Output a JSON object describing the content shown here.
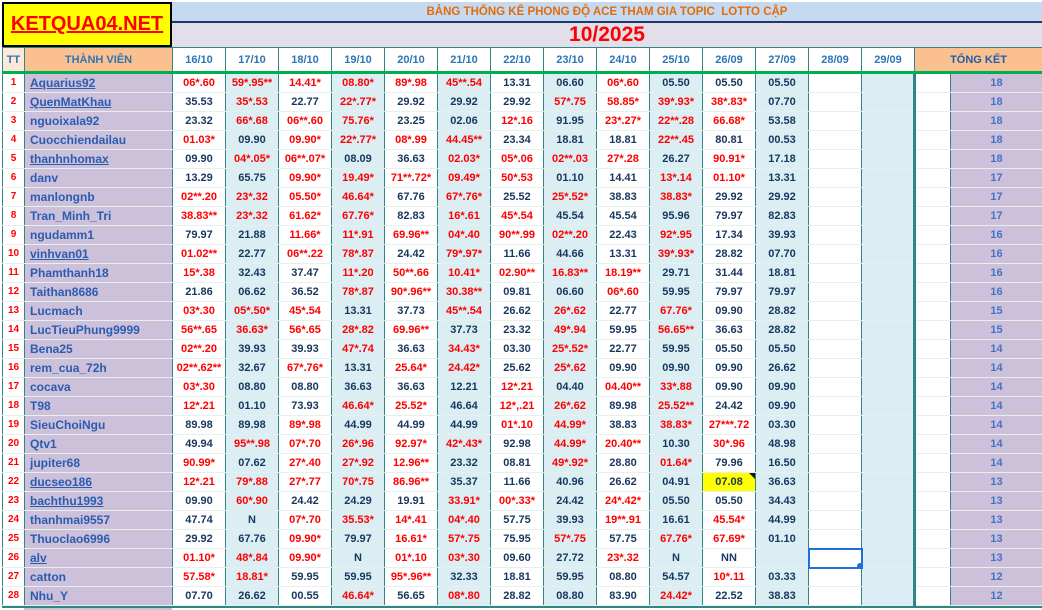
{
  "brand": {
    "site": "KETQUA04.NET"
  },
  "title_bar": {
    "title": "BẢNG THỐNG KÊ PHONG ĐỘ ACE THAM GIA TOPIC  LOTTO CẬP",
    "month": "10/2025"
  },
  "table": {
    "tt_label": "TT",
    "member_label": "THÀNH VIÊN",
    "total_label": "TỔNG KẾT",
    "dates": [
      "16/10",
      "17/10",
      "18/10",
      "19/10",
      "20/10",
      "21/10",
      "22/10",
      "23/10",
      "24/10",
      "25/10",
      "26/09",
      "27/09",
      "28/09",
      "29/09"
    ],
    "rows": [
      {
        "tt": 1,
        "name": "Aquarius92",
        "underline": true,
        "values": [
          "06*.60",
          "59*.95**",
          "14.41*",
          "08.80*",
          "89*.98",
          "45**.54",
          "13.31",
          "06.60",
          "06*.60",
          "05.50",
          "05.50",
          "05.50",
          "",
          ""
        ],
        "total": 18
      },
      {
        "tt": 2,
        "name": "QuenMatKhau",
        "underline": true,
        "values": [
          "35.53",
          "35*.53",
          "22.77",
          "22*.77*",
          "29.92",
          "29.92",
          "29.92",
          "57*.75",
          "58.85*",
          "39*.93*",
          "38*.83*",
          "07.70",
          "",
          ""
        ],
        "total": 18
      },
      {
        "tt": 3,
        "name": "nguoixala92",
        "underline": false,
        "values": [
          "23.32",
          "66*.68",
          "06**.60",
          "75.76*",
          "23.25",
          "02.06",
          "12*.16",
          "91.95",
          "23*.27*",
          "22**.28",
          "66.68*",
          "53.58",
          "",
          ""
        ],
        "total": 18
      },
      {
        "tt": 4,
        "name": "Cuocchiendailau",
        "underline": false,
        "values": [
          "01.03*",
          "09.90",
          "09.90*",
          "22*.77*",
          "08*.99",
          "44.45**",
          "23.34",
          "18.81",
          "18.81",
          "22**.45",
          "80.81",
          "00.53",
          "",
          ""
        ],
        "total": 18
      },
      {
        "tt": 5,
        "name": "thanhnhomax",
        "underline": true,
        "values": [
          "09.90",
          "04*.05*",
          "06**.07*",
          "08.09",
          "36.63",
          "02.03*",
          "05*.06",
          "02**.03",
          "27*.28",
          "26.27",
          "90.91*",
          "17.18",
          "",
          ""
        ],
        "total": 18
      },
      {
        "tt": 6,
        "name": "danv",
        "underline": false,
        "values": [
          "13.29",
          "65.75",
          "09.90*",
          "19.49*",
          "71**.72*",
          "09.49*",
          "50*.53",
          "01.10",
          "14.41",
          "13*.14",
          "01.10*",
          "13.31",
          "",
          ""
        ],
        "total": 17
      },
      {
        "tt": 7,
        "name": "manlongnb",
        "underline": false,
        "values": [
          "02**.20",
          "23*.32",
          "05.50*",
          "46.64*",
          "67.76",
          "67*.76*",
          "25.52",
          "25*.52*",
          "38.83",
          "38.83*",
          "29.92",
          "29.92",
          "",
          ""
        ],
        "total": 17
      },
      {
        "tt": 8,
        "name": "Tran_Minh_Tri",
        "underline": false,
        "values": [
          "38.83**",
          "23*.32",
          "61.62*",
          "67.76*",
          "82.83",
          "16*.61",
          "45*.54",
          "45.54",
          "45.54",
          "95.96",
          "79.97",
          "82.83",
          "",
          ""
        ],
        "total": 17
      },
      {
        "tt": 9,
        "name": "ngudamm1",
        "underline": false,
        "values": [
          "79.97",
          "21.88",
          "11.66*",
          "11*.91",
          "69.96**",
          "04*.40",
          "90**.99",
          "02**.20",
          "22.43",
          "92*.95",
          "17.34",
          "39.93",
          "",
          ""
        ],
        "total": 16
      },
      {
        "tt": 10,
        "name": "vinhvan01",
        "underline": true,
        "values": [
          "01.02**",
          "22.77",
          "06**.22",
          "78*.87",
          "24.42",
          "79*.97*",
          "11.66",
          "44.66",
          "13.31",
          "39*.93*",
          "28.82",
          "07.70",
          "",
          ""
        ],
        "total": 16
      },
      {
        "tt": 11,
        "name": "Phamthanh18",
        "underline": false,
        "values": [
          "15*.38",
          "32.43",
          "37.47",
          "11*.20",
          "50**.66",
          "10.41*",
          "02.90**",
          "16.83**",
          "18.19**",
          "29.71",
          "31.44",
          "18.81",
          "",
          ""
        ],
        "total": 16
      },
      {
        "tt": 12,
        "name": "Taithan8686",
        "underline": false,
        "values": [
          "21.86",
          "06.62",
          "36.52",
          "78*.87",
          "90*.96**",
          "30.38**",
          "09.81",
          "06.60",
          "06*.60",
          "59.95",
          "79.97",
          "79.97",
          "",
          ""
        ],
        "total": 16
      },
      {
        "tt": 13,
        "name": "Lucmach",
        "underline": false,
        "values": [
          "03*.30",
          "05*.50*",
          "45*.54",
          "13.31",
          "37.73",
          "45**.54",
          "26.62",
          "26*.62",
          "22.77",
          "67.76*",
          "09.90",
          "28.82",
          "",
          ""
        ],
        "total": 15
      },
      {
        "tt": 14,
        "name": "LucTieuPhung9999",
        "underline": false,
        "values": [
          "56**.65",
          "36.63*",
          "56*.65",
          "28*.82",
          "69.96**",
          "37.73",
          "23.32",
          "49*.94",
          "59.95",
          "56.65**",
          "36.63",
          "28.82",
          "",
          ""
        ],
        "total": 15
      },
      {
        "tt": 15,
        "name": "Bena25",
        "underline": false,
        "values": [
          "02**.20",
          "39.93",
          "39.93",
          "47*.74",
          "36.63",
          "34.43*",
          "03.30",
          "25*.52*",
          "22.77",
          "59.95",
          "05.50",
          "05.50",
          "",
          ""
        ],
        "total": 14
      },
      {
        "tt": 16,
        "name": "rem_cua_72h",
        "underline": false,
        "values": [
          "02**.62**",
          "32.67",
          "67*.76*",
          "13.31",
          "25.64*",
          "24.42*",
          "25.62",
          "25*.62",
          "09.90",
          "09.90",
          "09.90",
          "26.62",
          "",
          ""
        ],
        "total": 14
      },
      {
        "tt": 17,
        "name": "cocava",
        "underline": false,
        "values": [
          "03*.30",
          "08.80",
          "08.80",
          "36.63",
          "36.63",
          "12.21",
          "12*.21",
          "04.40",
          "04.40**",
          "33*.88",
          "09.90",
          "09.90",
          "",
          ""
        ],
        "total": 14
      },
      {
        "tt": 18,
        "name": "T98",
        "underline": false,
        "values": [
          "12*.21",
          "01.10",
          "73.93",
          "46.64*",
          "25.52*",
          "46.64",
          "12*,.21",
          "26*.62",
          "89.98",
          "25.52**",
          "24.42",
          "09.90",
          "",
          ""
        ],
        "total": 14
      },
      {
        "tt": 19,
        "name": "SieuChoiNgu",
        "underline": false,
        "values": [
          "89.98",
          "89.98",
          "89*.98",
          "44.99",
          "44.99",
          "44.99",
          "01*.10",
          "44.99*",
          "38.83",
          "38.83*",
          "27***.72",
          "03.30",
          "",
          ""
        ],
        "total": 14
      },
      {
        "tt": 20,
        "name": "Qtv1",
        "underline": false,
        "values": [
          "49.94",
          "95**.98",
          "07*.70",
          "26*.96",
          "92.97*",
          "42*.43*",
          "92.98",
          "44.99*",
          "20.40**",
          "10.30",
          "30*.96",
          "48.98",
          "",
          ""
        ],
        "total": 14
      },
      {
        "tt": 21,
        "name": "jupiter68",
        "underline": false,
        "values": [
          "90.99*",
          "07.62",
          "27*.40",
          "27*.92",
          "12.96**",
          "23.32",
          "08.81",
          "49*.92*",
          "28.80",
          "01.64*",
          "79.96",
          "16.50",
          "",
          ""
        ],
        "total": 14
      },
      {
        "tt": 22,
        "name": "ducseo186",
        "underline": true,
        "values": [
          "12*.21",
          "79*.88",
          "27*.77",
          "70*.75",
          "86.96**",
          "35.37",
          "11.66",
          "40.96",
          "26.62",
          "04.91",
          "07.08",
          "36.63",
          "",
          ""
        ],
        "total": 13
      },
      {
        "tt": 23,
        "name": "bachthu1993",
        "underline": true,
        "values": [
          "09.90",
          "60*.90",
          "24.42",
          "24.29",
          "19.91",
          "33.91*",
          "00*.33*",
          "24.42",
          "24*.42*",
          "05.50",
          "05.50",
          "34.43",
          "",
          ""
        ],
        "total": 13
      },
      {
        "tt": 24,
        "name": "thanhmai9557",
        "underline": false,
        "values": [
          "47.74",
          "N",
          "07*.70",
          "35.53*",
          "14*.41",
          "04*.40",
          "57.75",
          "39.93",
          "19**.91",
          "16.61",
          "45.54*",
          "44.99",
          "",
          ""
        ],
        "total": 13
      },
      {
        "tt": 25,
        "name": "Thuoclao6996",
        "underline": false,
        "values": [
          "29.92",
          "67.76",
          "09.90*",
          "79.97",
          "16.61*",
          "57*.75",
          "75.95",
          "57*.75",
          "57.75",
          "67.76*",
          "67.69*",
          "01.10",
          "",
          ""
        ],
        "total": 13
      },
      {
        "tt": 26,
        "name": "alv",
        "underline": true,
        "values": [
          "01.10*",
          "48*.84",
          "09.90*",
          "N",
          "01*.10",
          "03*.30",
          "09.60",
          "27.72",
          "23*.32",
          "N",
          "NN",
          "",
          "",
          ""
        ],
        "total": 13
      },
      {
        "tt": 27,
        "name": "catton",
        "underline": false,
        "values": [
          "57.58*",
          "18.81*",
          "59.95",
          "59.95",
          "95*.96**",
          "32.33",
          "18.81",
          "59.95",
          "08.80",
          "54.57",
          "10*.11",
          "03.33",
          "",
          ""
        ],
        "total": 12
      },
      {
        "tt": 28,
        "name": "Nhu_Y",
        "underline": false,
        "values": [
          "07.70",
          "26.62",
          "00.55",
          "46.64*",
          "56.65",
          "08*.80",
          "28.82",
          "08.80",
          "83.90",
          "24.42*",
          "22.52",
          "38.83",
          "",
          ""
        ],
        "total": 12
      }
    ],
    "highlight_cell": {
      "row_tt": 22,
      "date": "26/09",
      "color": "#FFFF00",
      "note_marker": true
    },
    "selected_cell": {
      "row_tt": 26,
      "date": "28/09"
    }
  },
  "colors": {
    "logo_bg": "#FFFF00",
    "logo_text": "#FF0000",
    "title_text": "#E36C0A",
    "title_band_bg": "#C5D9F1",
    "month_band_bg": "#E2DEEA",
    "month_text": "#FF0000",
    "header_peach": "#FAC090",
    "header_peach_light": "#FDE9D9",
    "header_text_blue": "#2E75B6",
    "name_col_bg": "#CCC0DA",
    "alt_col_bg": "#DAEEF3",
    "starred_value": "#FF0000",
    "normal_value": "#17375E",
    "member_link": "#2A5CAF",
    "total_value": "#4472C4",
    "grid_line": "#318585",
    "header_underline": "#00B050",
    "selection": "#1E6FD9",
    "highlight": "#FFFF00"
  }
}
